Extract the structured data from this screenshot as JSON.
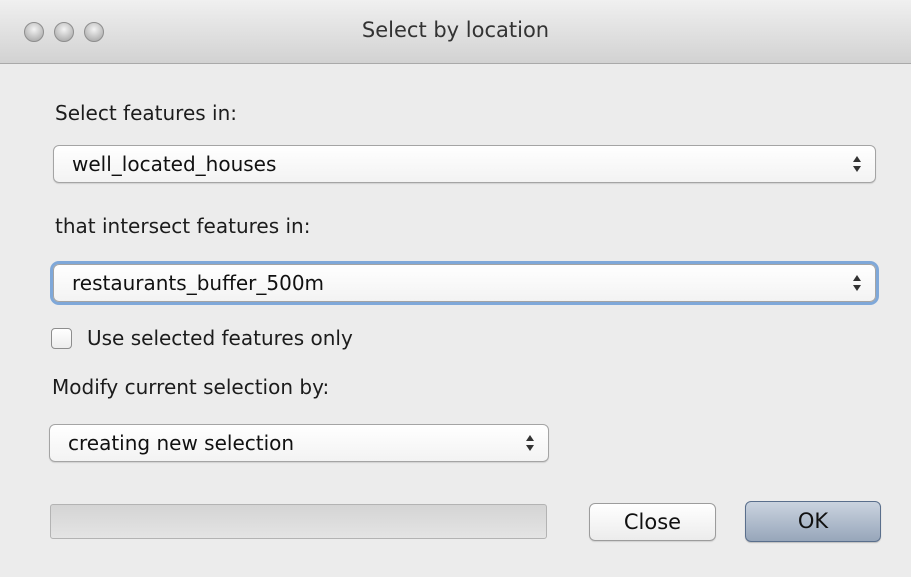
{
  "window": {
    "title": "Select by location"
  },
  "form": {
    "select_features_label": "Select features in:",
    "target_layer": "well_located_houses",
    "intersect_label": "that intersect features in:",
    "intersect_layer": "restaurants_buffer_500m",
    "selected_only_label": "Use selected features only",
    "selected_only_checked": false,
    "modify_label": "Modify current selection by:",
    "modify_option": "creating new selection"
  },
  "progress": {
    "value": 0
  },
  "buttons": {
    "close": "Close",
    "ok": "OK"
  },
  "icons": {
    "close_window": "close-window-icon",
    "minimize_window": "minimize-window-icon",
    "zoom_window": "zoom-window-icon",
    "select_arrows": "up-down-arrows-icon"
  }
}
